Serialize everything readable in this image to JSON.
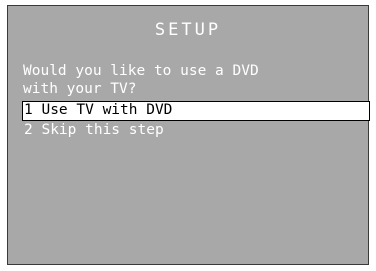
{
  "screen": {
    "title": "SETUP",
    "prompt": "Would you like to use a DVD\nwith your TV?",
    "menu": [
      {
        "label": "1 Use TV with DVD",
        "selected": true
      },
      {
        "label": "2 Skip this step",
        "selected": false
      }
    ]
  },
  "colors": {
    "background": "#a8a8a8",
    "text": "#ffffff",
    "highlight_bg": "#ffffff",
    "highlight_text": "#000000"
  }
}
